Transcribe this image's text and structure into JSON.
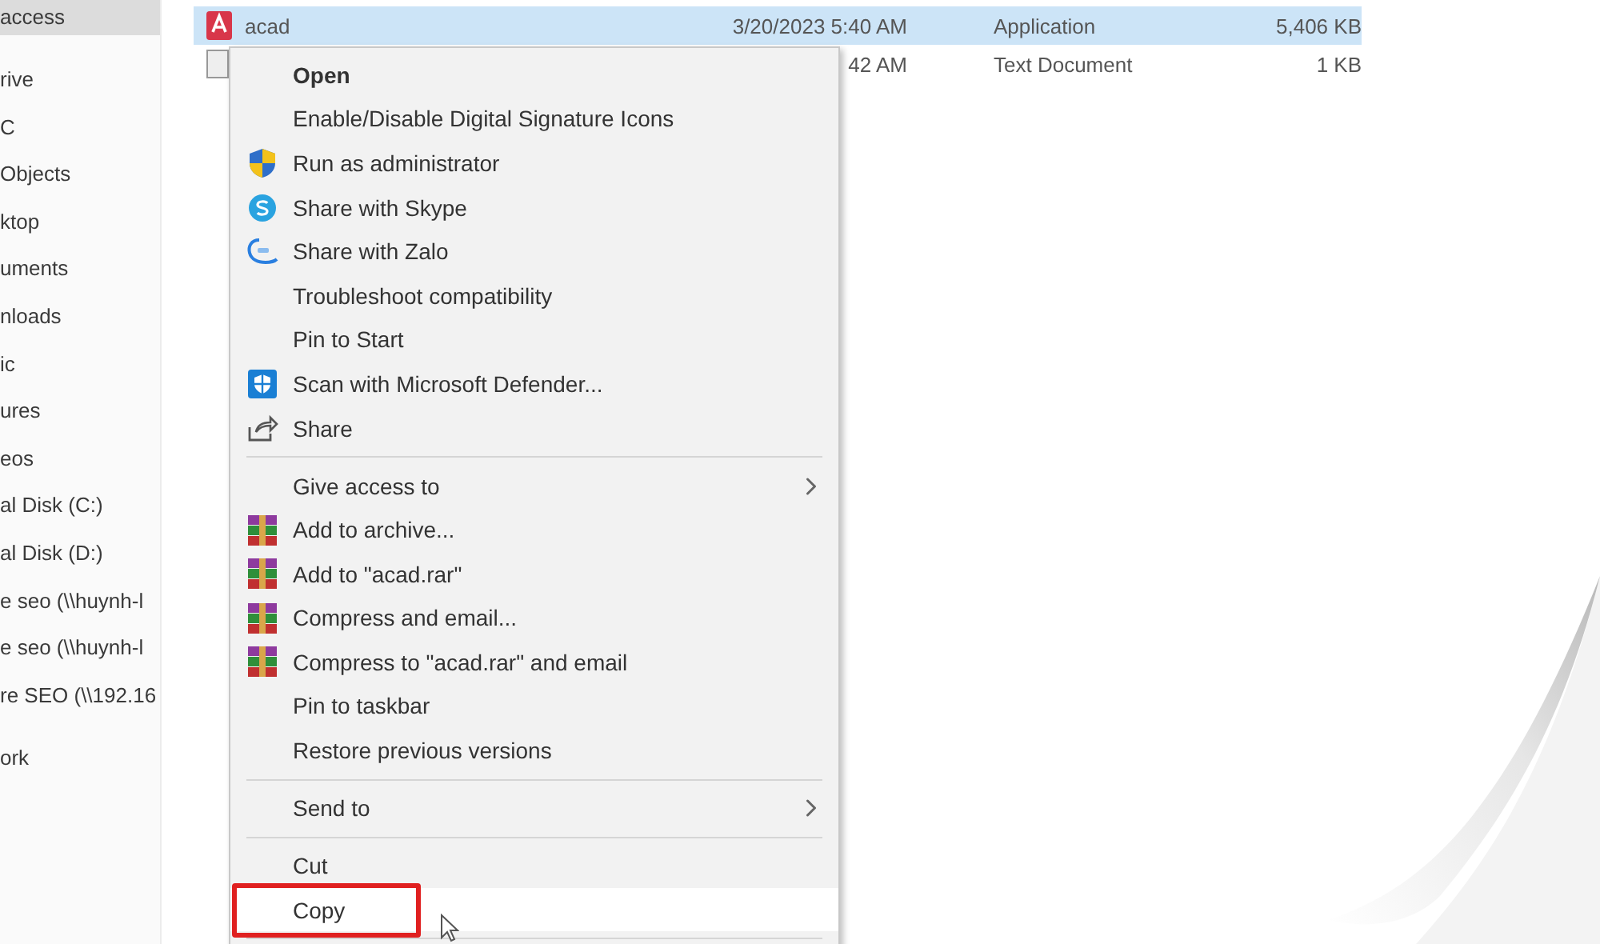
{
  "sidebar": {
    "items": [
      {
        "label": "access",
        "selected": true
      },
      {
        "label": "rive",
        "selected": false
      },
      {
        "label": "C",
        "selected": false
      },
      {
        "label": "Objects",
        "selected": false
      },
      {
        "label": "ktop",
        "selected": false
      },
      {
        "label": "uments",
        "selected": false
      },
      {
        "label": "nloads",
        "selected": false
      },
      {
        "label": "ic",
        "selected": false
      },
      {
        "label": "ures",
        "selected": false
      },
      {
        "label": "eos",
        "selected": false
      },
      {
        "label": "al Disk (C:)",
        "selected": false
      },
      {
        "label": "al Disk (D:)",
        "selected": false
      },
      {
        "label": "e seo (\\\\huynh-l",
        "selected": false
      },
      {
        "label": "e seo (\\\\huynh-l",
        "selected": false
      },
      {
        "label": "re SEO (\\\\192.16",
        "selected": false
      },
      {
        "label": "ork",
        "selected": false
      }
    ]
  },
  "files": [
    {
      "kind": "app",
      "name": "acad",
      "date": "3/20/2023 5:40 AM",
      "type": "Application",
      "size": "5,406 KB",
      "selected": true
    },
    {
      "kind": "text",
      "date": "42 AM",
      "type": "Text Document",
      "size": "1 KB",
      "selected": false
    }
  ],
  "context_menu": {
    "items": [
      {
        "kind": "plain",
        "label": "Open",
        "default": true
      },
      {
        "kind": "plain",
        "label": "Enable/Disable Digital Signature Icons"
      },
      {
        "kind": "uac",
        "label": "Run as administrator"
      },
      {
        "kind": "skype",
        "label": "Share with Skype"
      },
      {
        "kind": "zalo",
        "label": "Share with Zalo"
      },
      {
        "kind": "plain",
        "label": "Troubleshoot compatibility"
      },
      {
        "kind": "plain",
        "label": "Pin to Start"
      },
      {
        "kind": "defender",
        "label": "Scan with Microsoft Defender..."
      },
      {
        "kind": "share",
        "label": "Share"
      },
      {
        "kind": "separator"
      },
      {
        "kind": "submenu",
        "label": "Give access to"
      },
      {
        "kind": "winrar",
        "label": "Add to archive..."
      },
      {
        "kind": "winrar",
        "label": "Add to \"acad.rar\""
      },
      {
        "kind": "winrar",
        "label": "Compress and email..."
      },
      {
        "kind": "winrar",
        "label": "Compress to \"acad.rar\" and email"
      },
      {
        "kind": "plain",
        "label": "Pin to taskbar"
      },
      {
        "kind": "plain",
        "label": "Restore previous versions"
      },
      {
        "kind": "separator"
      },
      {
        "kind": "submenu",
        "label": "Send to"
      },
      {
        "kind": "separator"
      },
      {
        "kind": "plain",
        "label": "Cut"
      },
      {
        "kind": "plain",
        "label": "Copy",
        "highlighted": true,
        "annotated": true
      },
      {
        "kind": "separator"
      }
    ]
  }
}
